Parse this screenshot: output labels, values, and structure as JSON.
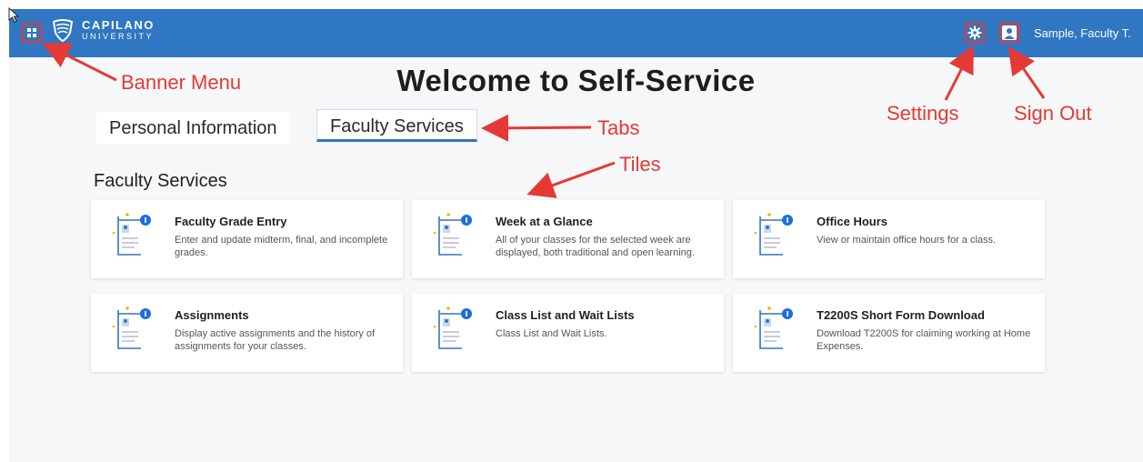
{
  "banner": {
    "brand_line1": "CAPILANO",
    "brand_line2": "UNIVERSITY",
    "user_name": "Sample, Faculty T.",
    "menu_icon": "grid-icon",
    "settings_icon": "gear-icon",
    "user_icon": "user-icon"
  },
  "page": {
    "title": "Welcome to Self-Service"
  },
  "tabs": [
    {
      "label": "Personal Information"
    },
    {
      "label": "Faculty Services"
    }
  ],
  "section": {
    "title": "Faculty Services"
  },
  "tiles": [
    {
      "title": "Faculty Grade Entry",
      "description": "Enter and update midterm, final, and incomplete grades."
    },
    {
      "title": "Week at a Glance",
      "description": "All of your classes for the selected week are displayed, both traditional and open learning."
    },
    {
      "title": "Office Hours",
      "description": "View or maintain office hours for a class."
    },
    {
      "title": "Assignments",
      "description": "Display active assignments and the history of assignments for your classes."
    },
    {
      "title": "Class List and Wait Lists",
      "description": "Class List and Wait Lists."
    },
    {
      "title": "T2200S Short Form Download",
      "description": "Download T2200S for claiming working at Home Expenses."
    }
  ],
  "annotations": {
    "banner_menu": "Banner Menu",
    "settings": "Settings",
    "sign_out": "Sign Out",
    "tabs": "Tabs",
    "tiles": "Tiles"
  },
  "colors": {
    "banner": "#2f77c2",
    "annotation": "#e53935"
  }
}
